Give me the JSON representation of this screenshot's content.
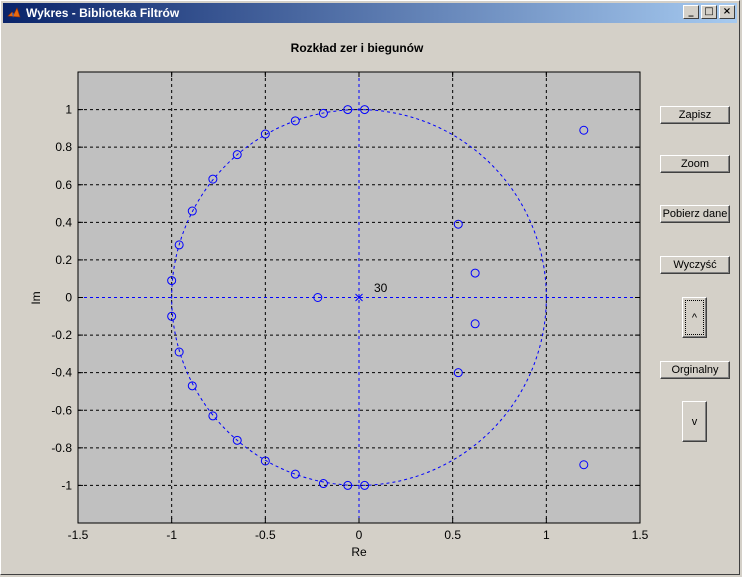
{
  "window": {
    "title": "Wykres - Biblioteka Filtrów",
    "controls": {
      "minimize": "_",
      "maximize": "□",
      "close": "×"
    }
  },
  "buttons": {
    "zapisz": "Zapisz",
    "zoom": "Zoom",
    "pobierz": "Pobierz dane",
    "wyczysc": "Wyczyść",
    "up": "^",
    "orginalny": "Orginalny",
    "down": "v"
  },
  "chart_data": {
    "type": "scatter",
    "title": "Rozkład zer i biegunów",
    "xlabel": "Re",
    "ylabel": "Im",
    "xlim": [
      -1.5,
      1.5
    ],
    "ylim": [
      -1.2,
      1.2
    ],
    "xticks": [
      -1.5,
      -1,
      -0.5,
      0,
      0.5,
      1,
      1.5
    ],
    "xtick_labels": [
      "-1.5",
      "-1",
      "-0.5",
      "0",
      "0.5",
      "1",
      "1.5"
    ],
    "yticks": [
      -1,
      -0.8,
      -0.6,
      -0.4,
      -0.2,
      0,
      0.2,
      0.4,
      0.6,
      0.8,
      1
    ],
    "ytick_labels": [
      "-1",
      "-0.8",
      "-0.6",
      "-0.4",
      "-0.2",
      "0",
      "0.2",
      "0.4",
      "0.6",
      "0.8",
      "1"
    ],
    "grid": true,
    "unit_circle": true,
    "colors": {
      "marker": "#0000ff",
      "axes_bg": "#c0c0c0",
      "grid": "#000000"
    },
    "zeros": [
      {
        "x": -0.06,
        "y": 1.0
      },
      {
        "x": 0.03,
        "y": 1.0
      },
      {
        "x": -0.19,
        "y": 0.98
      },
      {
        "x": -0.34,
        "y": 0.94
      },
      {
        "x": -0.5,
        "y": 0.87
      },
      {
        "x": -0.65,
        "y": 0.76
      },
      {
        "x": -0.78,
        "y": 0.63
      },
      {
        "x": -0.89,
        "y": 0.46
      },
      {
        "x": -0.96,
        "y": 0.28
      },
      {
        "x": -1.0,
        "y": 0.09
      },
      {
        "x": -1.0,
        "y": -0.1
      },
      {
        "x": -0.96,
        "y": -0.29
      },
      {
        "x": -0.89,
        "y": -0.47
      },
      {
        "x": -0.78,
        "y": -0.63
      },
      {
        "x": -0.65,
        "y": -0.76
      },
      {
        "x": -0.5,
        "y": -0.87
      },
      {
        "x": -0.34,
        "y": -0.94
      },
      {
        "x": -0.19,
        "y": -0.99
      },
      {
        "x": -0.06,
        "y": -1.0
      },
      {
        "x": 0.03,
        "y": -1.0
      },
      {
        "x": -0.22,
        "y": 0.0
      },
      {
        "x": 0.53,
        "y": 0.39
      },
      {
        "x": 0.53,
        "y": -0.4
      },
      {
        "x": 0.62,
        "y": 0.13
      },
      {
        "x": 0.62,
        "y": -0.14
      },
      {
        "x": 1.2,
        "y": 0.89
      },
      {
        "x": 1.2,
        "y": -0.89
      }
    ],
    "poles": [
      {
        "x": 0,
        "y": 0
      }
    ],
    "annotations": [
      {
        "text": "30",
        "x": 0.08,
        "y": 0.03
      }
    ]
  }
}
